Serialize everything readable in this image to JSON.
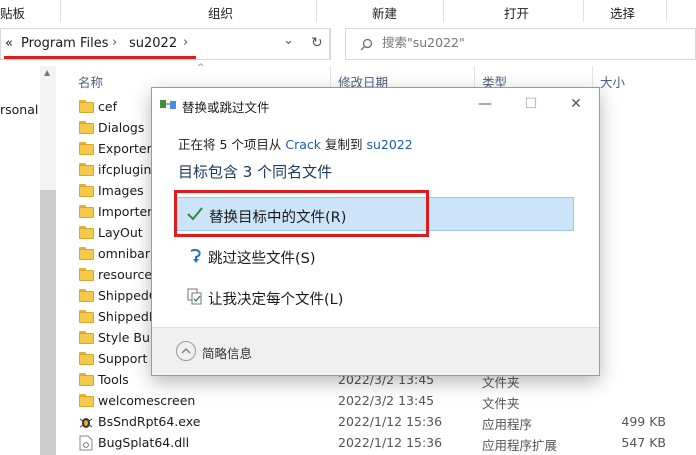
{
  "ribbon": {
    "groups": [
      "贴板",
      "组织",
      "新建",
      "打开",
      "选择"
    ]
  },
  "address": {
    "chevron": "«",
    "crumbs": [
      "Program Files",
      "su2022"
    ],
    "sep": "›",
    "dropdown": "⌄",
    "refresh": "↻"
  },
  "search": {
    "placeholder": "搜索\"su2022\""
  },
  "leftnav": {
    "partial_item": "rsonal"
  },
  "columns": {
    "name": "名称",
    "date": "修改日期",
    "type": "类型",
    "size": "大小"
  },
  "files": [
    {
      "name": "cef",
      "date": "",
      "type": "",
      "size": "",
      "kind": "folder"
    },
    {
      "name": "Dialogs",
      "date": "",
      "type": "",
      "size": "",
      "kind": "folder"
    },
    {
      "name": "Exporters",
      "date": "",
      "type": "",
      "size": "",
      "kind": "folder"
    },
    {
      "name": "ifcplugin",
      "date": "",
      "type": "",
      "size": "",
      "kind": "folder"
    },
    {
      "name": "Images",
      "date": "",
      "type": "",
      "size": "",
      "kind": "folder"
    },
    {
      "name": "Importers",
      "date": "",
      "type": "",
      "size": "",
      "kind": "folder"
    },
    {
      "name": "LayOut",
      "date": "",
      "type": "",
      "size": "",
      "kind": "folder"
    },
    {
      "name": "omnibar",
      "date": "",
      "type": "",
      "size": "",
      "kind": "folder"
    },
    {
      "name": "resources",
      "date": "",
      "type": "",
      "size": "",
      "kind": "folder"
    },
    {
      "name": "ShippedC",
      "date": "",
      "type": "",
      "size": "",
      "kind": "folder"
    },
    {
      "name": "ShippedE",
      "date": "",
      "type": "",
      "size": "",
      "kind": "folder"
    },
    {
      "name": "Style Buil",
      "date": "",
      "type": "",
      "size": "",
      "kind": "folder"
    },
    {
      "name": "Support",
      "date": "",
      "type": "",
      "size": "",
      "kind": "folder"
    },
    {
      "name": "Tools",
      "date": "2022/3/2 13:45",
      "type": "文件夹",
      "size": "",
      "kind": "folder"
    },
    {
      "name": "welcomescreen",
      "date": "2022/3/2 13:45",
      "type": "文件夹",
      "size": "",
      "kind": "folder"
    },
    {
      "name": "BsSndRpt64.exe",
      "date": "2022/1/12 15:36",
      "type": "应用程序",
      "size": "499 KB",
      "kind": "exe"
    },
    {
      "name": "BugSplat64.dll",
      "date": "2022/1/12 15:36",
      "type": "应用程序扩展",
      "size": "547 KB",
      "kind": "dll"
    }
  ],
  "dialog": {
    "title": "替换或跳过文件",
    "subtitle_pre": "正在将 5 个项目从 ",
    "source": "Crack",
    "subtitle_mid": " 复制到 ",
    "dest": "su2022",
    "heading": "目标包含 3 个同名文件",
    "options": {
      "replace": "替换目标中的文件(R)",
      "skip": "跳过这些文件(S)",
      "decide": "让我决定每个文件(L)"
    },
    "details": "简略信息",
    "min": "—",
    "max": "☐",
    "close": "✕"
  },
  "colors": {
    "accent": "#1a5bb8",
    "selection": "#cce4f7",
    "annotation": "#e01b1b"
  },
  "icons": {
    "replace": "check-icon",
    "skip": "skip-arrow-icon",
    "decide": "compare-files-icon"
  }
}
